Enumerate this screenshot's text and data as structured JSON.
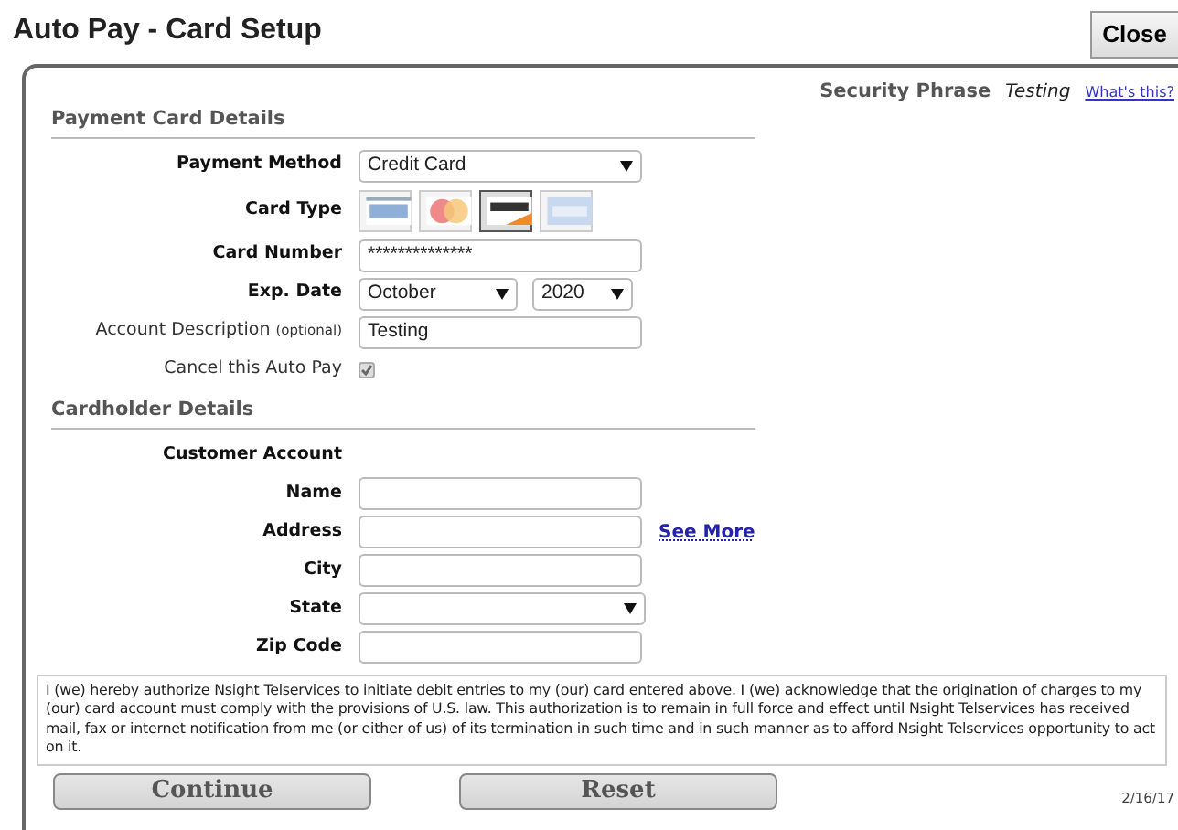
{
  "window": {
    "title": "Auto Pay - Card Setup",
    "close_button": "Close"
  },
  "security": {
    "label": "Security Phrase",
    "value": "Testing",
    "help_link": "What's this?"
  },
  "payment_section": {
    "heading": "Payment Card Details",
    "payment_method": {
      "label": "Payment Method",
      "value": "Credit Card"
    },
    "card_type": {
      "label": "Card Type",
      "cards": [
        {
          "kind": "visa",
          "selected": false
        },
        {
          "kind": "mastercard",
          "selected": false
        },
        {
          "kind": "discover",
          "selected": true
        },
        {
          "kind": "amex",
          "selected": false
        }
      ]
    },
    "card_number": {
      "label": "Card Number",
      "value": "**************"
    },
    "exp_date": {
      "label": "Exp. Date",
      "month": "October",
      "year": "2020"
    },
    "account_description": {
      "label": "Account Description",
      "hint": "(optional)",
      "value": "Testing"
    },
    "cancel_auto_pay": {
      "label": "Cancel this Auto Pay",
      "checked": true
    }
  },
  "cardholder_section": {
    "heading": "Cardholder Details",
    "customer_account": "Customer Account",
    "fields": [
      {
        "kind": "text",
        "label": "Name"
      },
      {
        "kind": "text",
        "label": "Address",
        "link": "See More"
      },
      {
        "kind": "text",
        "label": "City"
      },
      {
        "kind": "select",
        "label": "State"
      },
      {
        "kind": "text",
        "label": "Zip Code"
      }
    ]
  },
  "authorization": "I (we) hereby authorize Nsight Telservices to initiate debit entries to my (our) card entered above. I (we) acknowledge that the origination of charges to my (our) card account must comply with the provisions of U.S. law. This authorization is to remain in full force and effect until Nsight Telservices has received mail, fax or internet notification from me (or either of us) of its termination in such time and in such manner as to afford Nsight Telservices opportunity to act on it.",
  "buttons": [
    "Continue",
    "Reset"
  ],
  "footer_date": "2/16/17"
}
